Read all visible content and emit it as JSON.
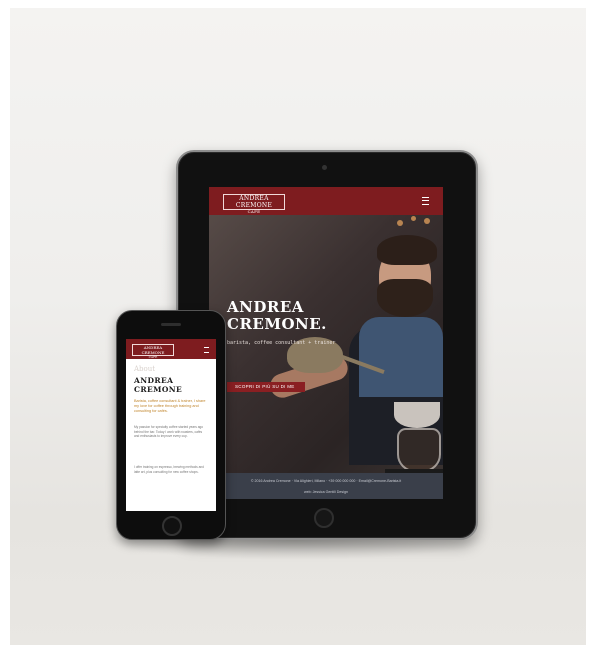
{
  "tablet": {
    "logo": "ANDREA CREMONE",
    "logo_sub": "CAFÉ",
    "hero_title_line1": "ANDREA",
    "hero_title_line2": "CREMONE.",
    "hero_subtitle": "barista, coffee consultant + trainer",
    "cta_label": "SCOPRI DI PIÙ SU DI ME",
    "footer_line1": "© 2016 Andrea Cremone · Via Alighieri, Milano · +39 000 000 000 · Email@Cremone-Barista.it",
    "footer_line2": "web: Jessica Gentili Design"
  },
  "phone": {
    "logo": "ANDREA CREMONE",
    "logo_sub": "CAFÉ",
    "about_label": "About",
    "name_line1": "ANDREA",
    "name_line2": "CREMONE",
    "lead": "Barista, coffee consultant & trainer, I share my love for coffee through training and consulting for cafés.",
    "para1": "My passion for specialty coffee started years ago behind the bar. Today I work with roasters, cafés and enthusiasts to improve every cup.",
    "para2": "I offer training on espresso, brewing methods and latte art, plus consulting for new coffee shops."
  },
  "colors": {
    "brand_red": "#7e1c1f",
    "accent_gold": "#c0842a",
    "footer_bg": "#3a3f4a"
  }
}
